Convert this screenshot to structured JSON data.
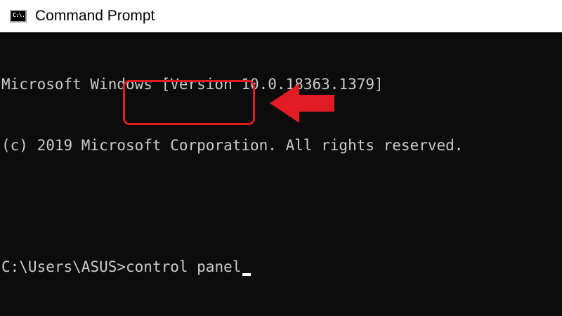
{
  "window": {
    "title": "Command Prompt",
    "icon": "C:\\."
  },
  "console": {
    "lines": [
      "Microsoft Windows [Version 10.0.18363.1379]",
      "(c) 2019 Microsoft Corporation. All rights reserved."
    ],
    "prompt": "C:\\Users\\ASUS>",
    "command": "control panel"
  },
  "colors": {
    "console_bg": "#0c0c0c",
    "console_text": "#cccccc",
    "annotation_red": "#e01b24"
  },
  "icons": {
    "app": "cmd-icon",
    "annotation": "arrow-left-icon"
  }
}
